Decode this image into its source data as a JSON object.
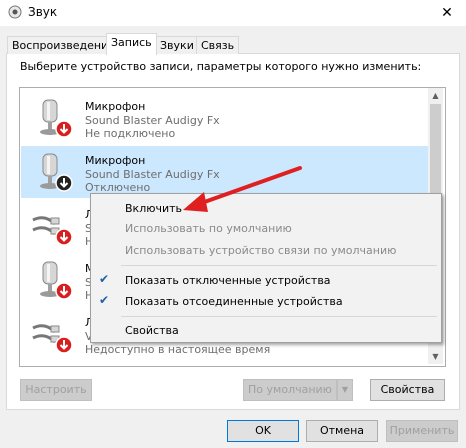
{
  "window": {
    "title": "Звук",
    "close_glyph": "✕"
  },
  "tabs": [
    {
      "label": "Воспроизведение",
      "active": false
    },
    {
      "label": "Запись",
      "active": true
    },
    {
      "label": "Звуки",
      "active": false
    },
    {
      "label": "Связь",
      "active": false
    }
  ],
  "instruction": "Выберите устройство записи, параметры которого нужно изменить:",
  "devices": [
    {
      "icon": "microphone-icon",
      "name": "Микрофон",
      "subtitle": "Sound Blaster Audigy Fx",
      "status": "Не подключено",
      "selected": false
    },
    {
      "icon": "microphone-icon",
      "name": "Микрофон",
      "subtitle": "Sound Blaster Audigy Fx",
      "status": "Отключено",
      "selected": true
    },
    {
      "icon": "line-in-icon",
      "name": "Л",
      "subtitle": "S",
      "status": "Н",
      "selected": false
    },
    {
      "icon": "microphone-icon",
      "name": "М",
      "subtitle": "S",
      "status": "Н",
      "selected": false
    },
    {
      "icon": "line-in-icon",
      "name": "Л",
      "subtitle": "V",
      "status": "Недоступно в настоящее время",
      "selected": false
    }
  ],
  "context_menu": {
    "items": [
      {
        "label": "Включить",
        "disabled": false,
        "checked": false
      },
      {
        "label": "Использовать по умолчанию",
        "disabled": true,
        "checked": false
      },
      {
        "label": "Использовать устройство связи по умолчанию",
        "disabled": true,
        "checked": false
      },
      {
        "label": "Показать отключенные устройства",
        "disabled": false,
        "checked": true
      },
      {
        "label": "Показать отсоединенные устройства",
        "disabled": false,
        "checked": true
      },
      {
        "label": "Свойства",
        "disabled": false,
        "checked": false
      }
    ]
  },
  "buttons": {
    "configure": "Настроить",
    "set_default": "По умолчанию",
    "properties": "Свойства",
    "ok": "OK",
    "cancel": "Отмена",
    "apply": "Применить"
  },
  "colors": {
    "selection": "#cce8ff",
    "arrow": "#e02020",
    "status_down": "#d81e1e",
    "check": "#1f5fa8"
  }
}
